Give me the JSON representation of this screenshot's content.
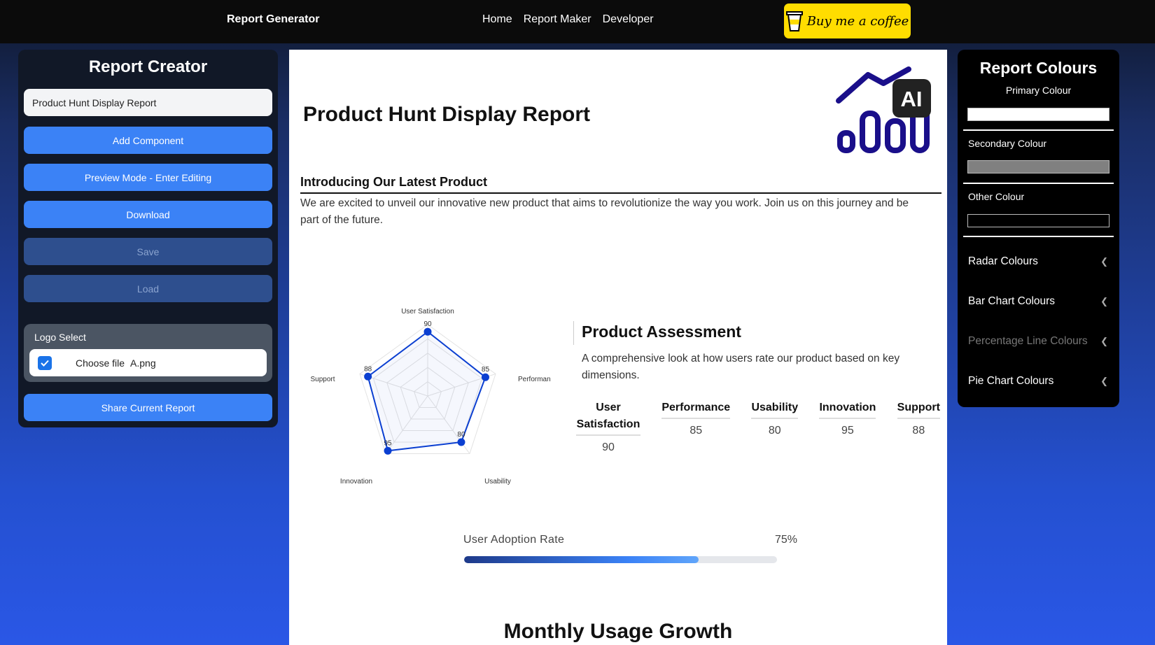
{
  "nav": {
    "brand": "Report Generator",
    "links": [
      "Home",
      "Report Maker",
      "Developer"
    ],
    "coffee": "Buy me a coffee"
  },
  "left": {
    "title": "Report Creator",
    "report_name": "Product Hunt Display Report",
    "buttons": [
      "Add Component",
      "Preview Mode - Enter Editing",
      "Download",
      "Save",
      "Load"
    ],
    "logo_select": {
      "label": "Logo Select",
      "choose": "Choose file",
      "filename": "A.png",
      "checked": true
    },
    "share": "Share Current Report"
  },
  "main": {
    "title": "Product Hunt Display Report",
    "logo_badge": "AI",
    "intro_heading": "Introducing Our Latest Product",
    "intro_text": "We are excited to unveil our innovative new product that aims to revolutionize the way you work. Join us on this journey and be part of the future.",
    "assessment": {
      "heading": "Product Assessment",
      "text": "A comprehensive look at how users rate our product based on key dimensions.",
      "metrics": [
        {
          "name": "User Satisfaction",
          "value": "90"
        },
        {
          "name": "Performance",
          "value": "85"
        },
        {
          "name": "Usability",
          "value": "80"
        },
        {
          "name": "Innovation",
          "value": "95"
        },
        {
          "name": "Support",
          "value": "88"
        }
      ]
    },
    "adoption": {
      "label": "User Adoption Rate",
      "percent_text": "75%",
      "value": 0.75
    },
    "growth_heading": "Monthly Usage Growth"
  },
  "chart_data": {
    "type": "radar",
    "categories": [
      "User Satisfaction",
      "Performance",
      "Usability",
      "Innovation",
      "Support"
    ],
    "axis_labels": [
      "User Satisfaction",
      "Performan",
      "Usability",
      "Innovation",
      "Support"
    ],
    "values": [
      90,
      85,
      80,
      95,
      88
    ],
    "range": [
      0,
      100
    ],
    "color": "#0b3fd1"
  },
  "right": {
    "title": "Report Colours",
    "primary_label": "Primary Colour",
    "primary": "#ffffff",
    "secondary_label": "Secondary Colour",
    "secondary": "#808080",
    "other_label": "Other Colour",
    "other": "#000000",
    "accordions": [
      {
        "label": "Radar Colours",
        "enabled": true
      },
      {
        "label": "Bar Chart Colours",
        "enabled": true
      },
      {
        "label": "Percentage Line Colours",
        "enabled": false
      },
      {
        "label": "Pie Chart Colours",
        "enabled": true
      }
    ]
  },
  "colors": {
    "accent": "#3b82f6",
    "coffee": "#ffdd00",
    "logo": "#1a0f8a"
  }
}
